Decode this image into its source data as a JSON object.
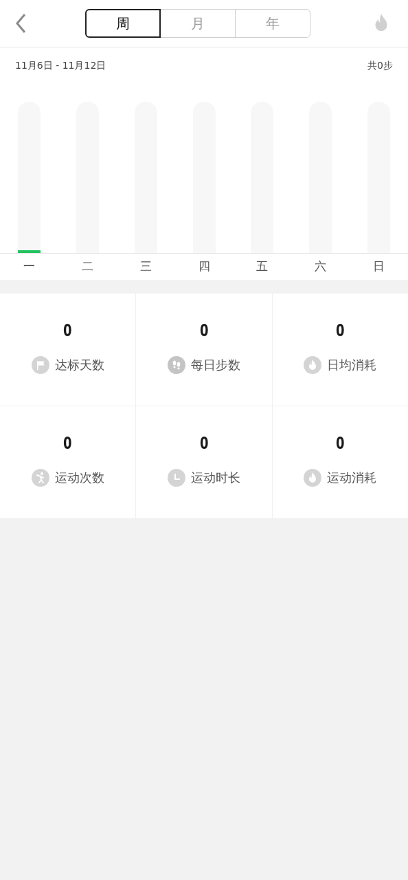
{
  "tabs": [
    {
      "label": "周",
      "selected": true
    },
    {
      "label": "月",
      "selected": false
    },
    {
      "label": "年",
      "selected": false
    }
  ],
  "date_range": "11月6日 - 11月12日",
  "total": "共0步",
  "days": [
    {
      "label": "一",
      "selected": true
    },
    {
      "label": "二",
      "selected": false
    },
    {
      "label": "三",
      "selected": false
    },
    {
      "label": "四",
      "selected": false
    },
    {
      "label": "五",
      "selected": false
    },
    {
      "label": "六",
      "selected": false
    },
    {
      "label": "日",
      "selected": false
    }
  ],
  "stats": [
    {
      "value": "0",
      "label": "达标天数",
      "kind": "flag"
    },
    {
      "value": "0",
      "label": "每日步数",
      "kind": "steps"
    },
    {
      "value": "0",
      "label": "日均消耗",
      "kind": "flame"
    },
    {
      "value": "0",
      "label": "运动次数",
      "kind": "runner"
    },
    {
      "value": "0",
      "label": "运动时长",
      "kind": "clock"
    },
    {
      "value": "0",
      "label": "运动消耗",
      "kind": "flame"
    }
  ]
}
